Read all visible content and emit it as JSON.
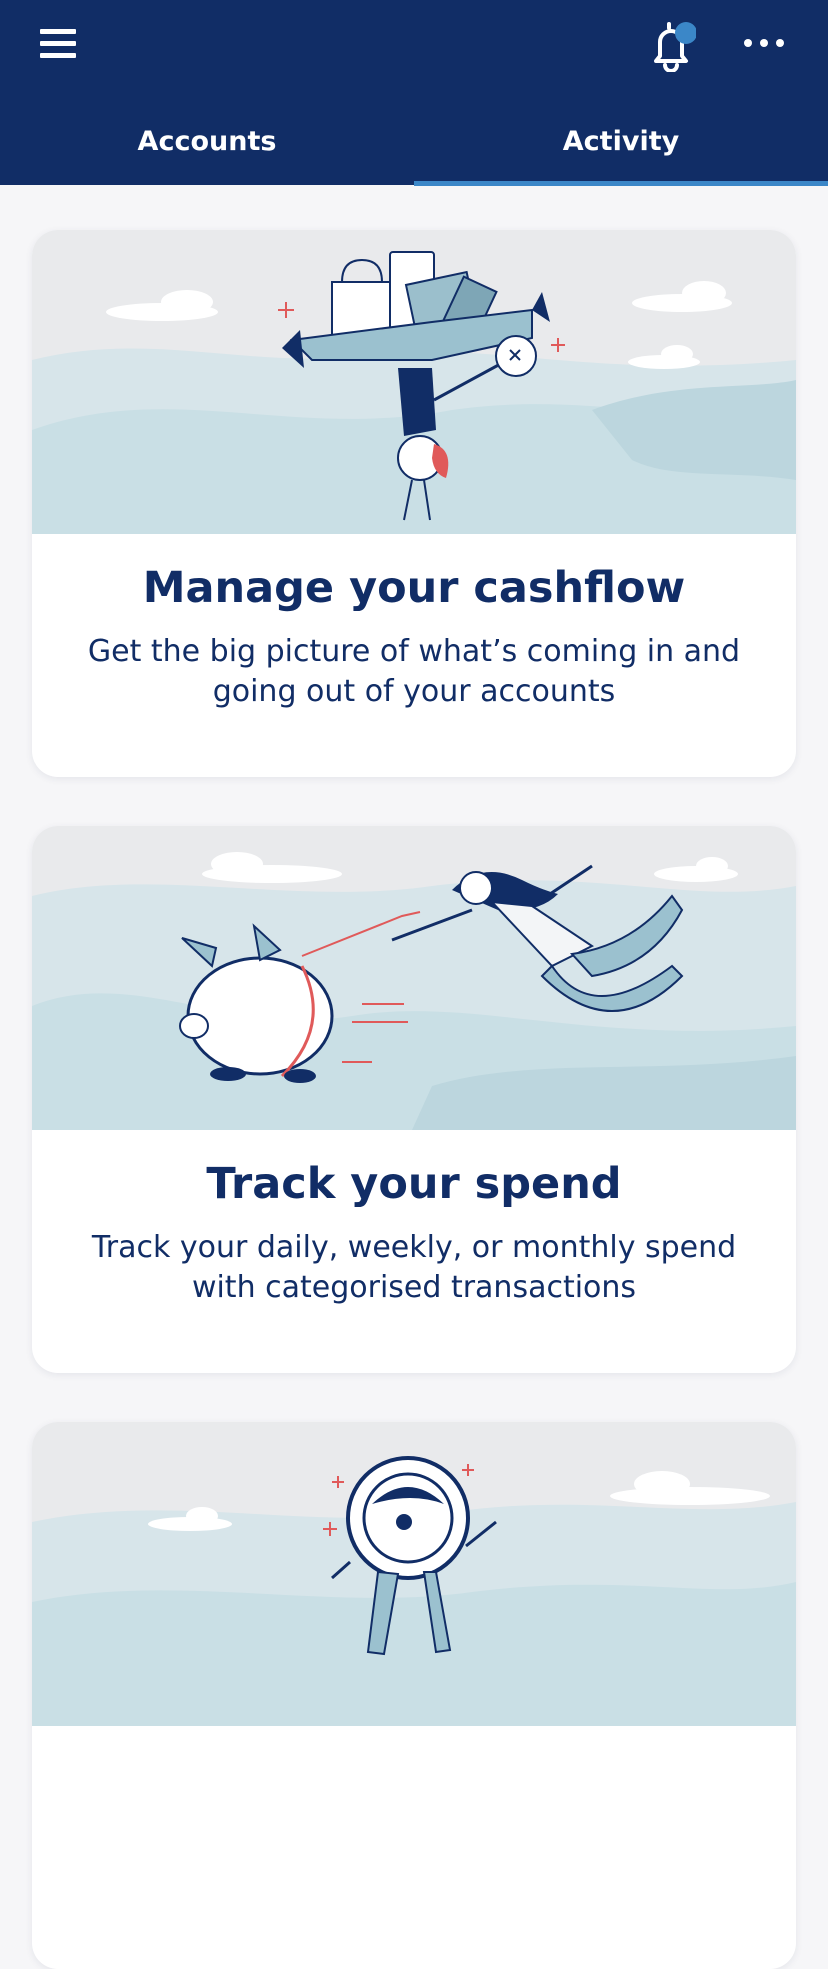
{
  "header": {
    "menu_icon": "hamburger-menu-icon",
    "notification_icon": "bell-icon",
    "more_icon": "more-horizontal-icon",
    "notification_dot_color": "#3b87c8",
    "background_color": "#112d66"
  },
  "tabs": [
    {
      "label": "Accounts",
      "active": false
    },
    {
      "label": "Activity",
      "active": true
    }
  ],
  "cards": [
    {
      "illustration": "person-handstand-balancing-shopping-bags",
      "title": "Manage your cashflow",
      "description": "Get the big picture of what’s coming in and going out of your accounts"
    },
    {
      "illustration": "woman-flying-with-piggy-bank-on-leash",
      "title": "Track your spend",
      "description": "Track your daily, weekly, or monthly spend with categorised transactions"
    },
    {
      "illustration": "magnifying-glass-character"
    }
  ],
  "colors": {
    "navy": "#112d66",
    "accent_blue": "#3b87c8",
    "hill_light": "#d7e5ea",
    "hill_mid": "#bcd6de",
    "accent_red": "#e05a5a"
  }
}
